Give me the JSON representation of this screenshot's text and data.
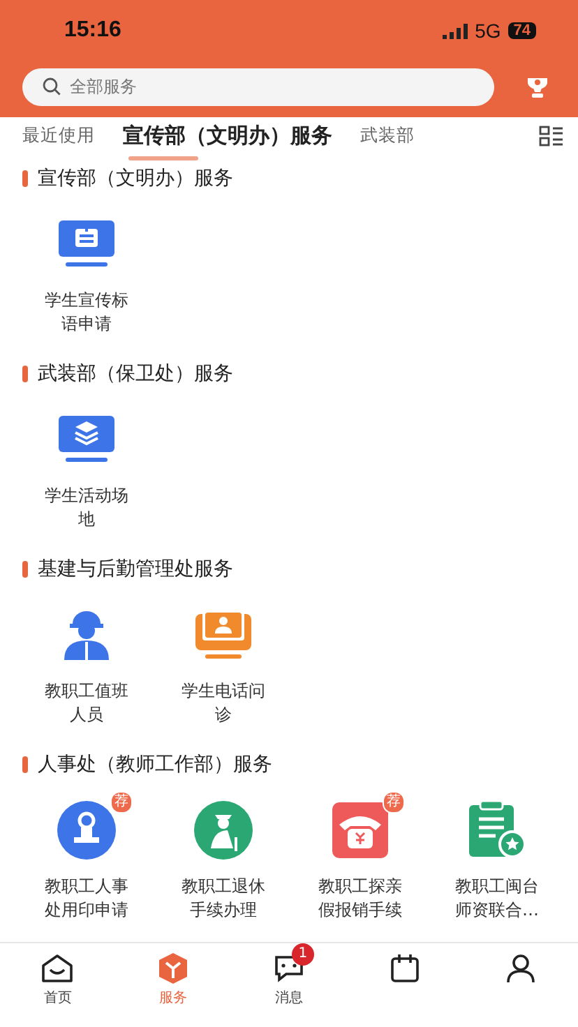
{
  "status_bar": {
    "time": "15:16",
    "network": "5G",
    "battery": "74"
  },
  "search": {
    "placeholder": "全部服务"
  },
  "tabs": [
    {
      "label": "最近使用",
      "selected": false
    },
    {
      "label": "宣传部（文明办）服务",
      "selected": true
    },
    {
      "label": "武装部",
      "selected": false
    }
  ],
  "sections": [
    {
      "title": "宣传部（文明办）服务",
      "items": [
        {
          "label": "学生宣传标语申请"
        }
      ]
    },
    {
      "title": "武装部（保卫处）服务",
      "items": [
        {
          "label": "学生活动场地"
        }
      ]
    },
    {
      "title": "基建与后勤管理处服务",
      "items": [
        {
          "label": "教职工值班人员"
        },
        {
          "label": "学生电话问诊"
        }
      ]
    },
    {
      "title": "人事处（教师工作部）服务",
      "items": [
        {
          "label": "教职工人事处用印申请",
          "badge": "荐"
        },
        {
          "label": "教职工退休手续办理"
        },
        {
          "label": "教职工探亲假报销手续",
          "badge": "荐"
        },
        {
          "label": "教职工闽台师资联合…"
        }
      ]
    }
  ],
  "nav": [
    {
      "label": "首页",
      "selected": false
    },
    {
      "label": "服务",
      "selected": true
    },
    {
      "label": "消息",
      "selected": false,
      "badge": "1"
    },
    {
      "selected": false
    },
    {
      "selected": false
    }
  ]
}
